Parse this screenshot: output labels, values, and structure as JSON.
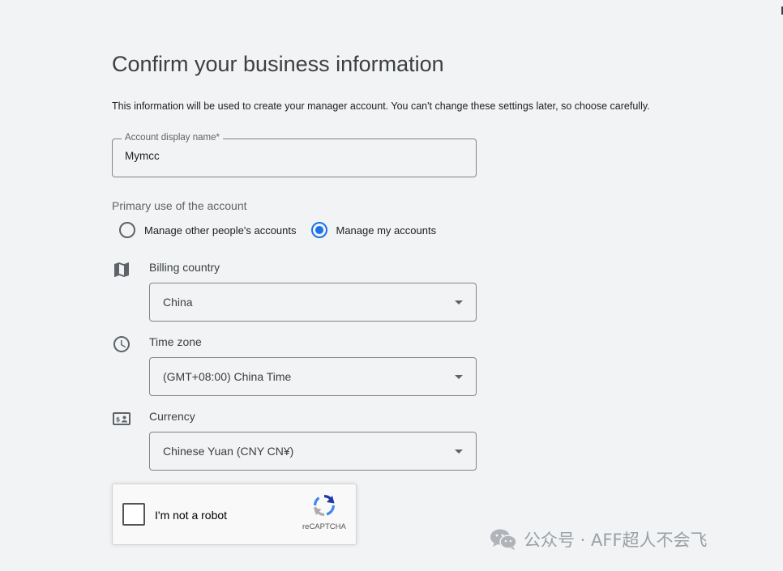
{
  "page": {
    "title": "Confirm your business information",
    "description": "This information will be used to create your manager account. You can't change these settings later, so choose carefully."
  },
  "account_name": {
    "label": "Account display name*",
    "value": "Mymcc"
  },
  "primary_use": {
    "label": "Primary use of the account",
    "options": [
      {
        "label": "Manage other people's accounts",
        "selected": false
      },
      {
        "label": "Manage my accounts",
        "selected": true
      }
    ]
  },
  "billing_country": {
    "label": "Billing country",
    "value": "China",
    "icon": "map-icon"
  },
  "time_zone": {
    "label": "Time zone",
    "value": "(GMT+08:00) China Time",
    "icon": "clock-icon"
  },
  "currency": {
    "label": "Currency",
    "value": "Chinese Yuan (CNY CN¥)",
    "icon": "currency-icon"
  },
  "captcha": {
    "label": "I'm not a robot",
    "brand": "reCAPTCHA"
  },
  "watermark": {
    "text": "公众号 · AFF超人不会飞"
  },
  "colors": {
    "accent": "#1a73e8",
    "background": "#f1f3f4"
  }
}
